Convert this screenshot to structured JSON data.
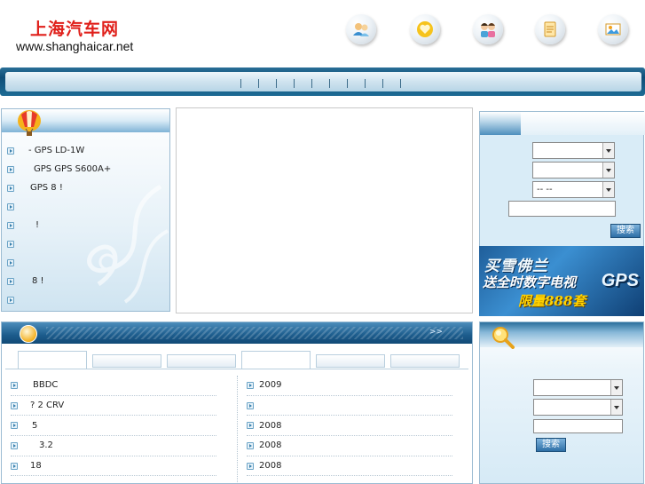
{
  "header": {
    "logo_cn": "上海汽车网",
    "logo_url": "www.shanghaicar.net",
    "top_icons": [
      "people-chat-icon",
      "heart-badge-icon",
      "couple-avatar-icon",
      "document-icon",
      "picture-icon"
    ]
  },
  "nav": {
    "separator_count": 10
  },
  "news": {
    "items": [
      {
        "text": "-    GPS    LD-1W"
      },
      {
        "text": "GPS   GPS S600A+"
      },
      {
        "text": "GPS     8  !"
      },
      {
        "text": ""
      },
      {
        "text": "!"
      },
      {
        "text": ""
      },
      {
        "text": ""
      },
      {
        "text": "8  !"
      },
      {
        "text": ""
      }
    ]
  },
  "search": {
    "select1": "",
    "select2": "",
    "select3": "--   --",
    "input_value": "",
    "button_label": "搜索"
  },
  "ad": {
    "line1": "买雪佛兰",
    "line2": "送全时数字电视",
    "gps": "GPS",
    "line3": "限量888套"
  },
  "content": {
    "more": ">>",
    "left_rows": [
      "BBDC",
      "?     2   CRV",
      "5",
      "3.2",
      "18"
    ],
    "right_rows": [
      "2009",
      "",
      "2008",
      "2008",
      "2008"
    ]
  },
  "search2": {
    "select1": "",
    "select2": "",
    "input_value": "",
    "button_label": "搜索"
  },
  "colors": {
    "brand_red": "#e0201b",
    "nav_blue": "#0f4e78",
    "panel_border": "#9bbbd2",
    "ad_yellow": "#ffd200"
  }
}
